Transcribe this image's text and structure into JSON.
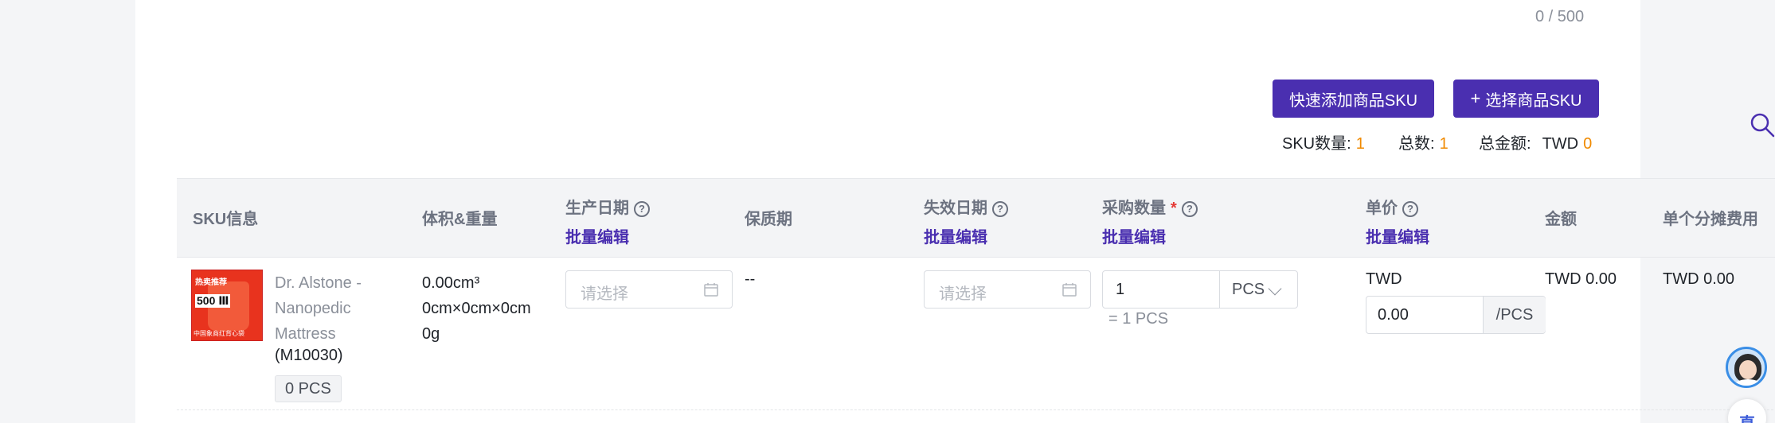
{
  "char_counter": "0 / 500",
  "actions": {
    "quick_add_label": "快速添加商品SKU",
    "select_sku_plus": "+",
    "select_sku_label": "选择商品SKU"
  },
  "summary": {
    "sku_count_label": "SKU数量:",
    "sku_count_value": "1",
    "total_count_label": "总数:",
    "total_count_value": "1",
    "total_amount_label": "总金额:",
    "currency": "TWD",
    "total_amount_value": "0"
  },
  "table": {
    "headers": {
      "sku_info": "SKU信息",
      "volume_weight": "体积&重量",
      "production_date": "生产日期",
      "shelf_life": "保质期",
      "expiry_date": "失效日期",
      "purchase_qty": "采购数量",
      "required_mark": "*",
      "unit_price": "单价",
      "amount": "金额",
      "allocated_fee": "单个分摊费用",
      "batch_edit": "批量编辑",
      "help_glyph": "?"
    },
    "rows": [
      {
        "thumb_text_top": "热卖推荐",
        "thumb_text_mid": "500 Ⅲ",
        "thumb_text_bottom": "中国象商红背心袋",
        "product_name": "Dr. Alstone - Nanopedic Mattress",
        "product_code": "(M10030)",
        "stock": "0 PCS",
        "volume": "0.00cm³",
        "dimensions": "0cm×0cm×0cm",
        "weight": "0g",
        "production_date_placeholder": "请选择",
        "shelf_life": "--",
        "expiry_date_placeholder": "请选择",
        "qty_value": "1",
        "qty_unit": "PCS",
        "qty_equivalent": "= 1 PCS",
        "price_currency": "TWD",
        "price_value": "0.00",
        "price_suffix": "/PCS",
        "amount": "TWD 0.00",
        "allocated_fee": "TWD 0.00"
      }
    ]
  },
  "floating": {
    "chat_glyph": "直"
  },
  "colors": {
    "primary": "#4a2fb0",
    "accent_orange": "#f08a00",
    "required_red": "#e53935"
  }
}
